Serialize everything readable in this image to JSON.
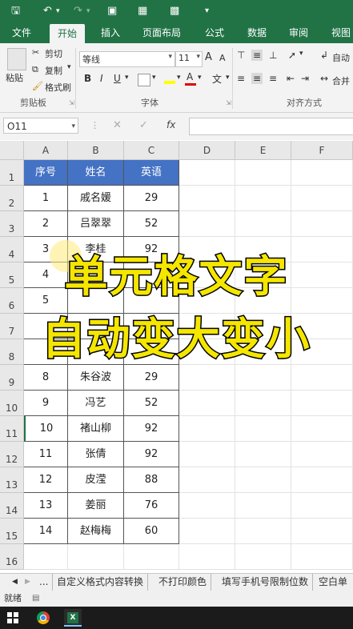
{
  "ribbon_tabs": [
    "文件",
    "开始",
    "插入",
    "页面布局",
    "公式",
    "数据",
    "审阅",
    "视图"
  ],
  "clipboard": {
    "paste": "粘贴",
    "cut": "剪切",
    "copy": "复制",
    "format_painter": "格式刷",
    "group": "剪贴板"
  },
  "font": {
    "name": "等线",
    "size": "11",
    "bold": "B",
    "italic": "I",
    "underline": "U",
    "group": "字体",
    "grow": "A",
    "shrink": "A",
    "color_a": "A",
    "wen": "文"
  },
  "alignment": {
    "wrap": "自动",
    "merge": "合并",
    "group": "对齐方式"
  },
  "name_box": "O11",
  "fx_label": "fx",
  "columns": [
    "A",
    "B",
    "C",
    "D",
    "E",
    "F"
  ],
  "rows": [
    "1",
    "2",
    "3",
    "4",
    "5",
    "6",
    "7",
    "8",
    "9",
    "10",
    "11",
    "12",
    "13",
    "14",
    "15",
    "16"
  ],
  "table": {
    "headers": [
      "序号",
      "姓名",
      "英语"
    ],
    "rows": [
      [
        "1",
        "戚名媛",
        "29"
      ],
      [
        "2",
        "吕翠翠",
        "52"
      ],
      [
        "3",
        "李桂",
        "92"
      ],
      [
        "4",
        "",
        "",
        ""
      ],
      [
        "5",
        "",
        "",
        ""
      ],
      [
        "",
        "",
        "",
        ""
      ],
      [
        "",
        "",
        "",
        ""
      ],
      [
        "8",
        "朱谷波",
        "29"
      ],
      [
        "9",
        "冯艺",
        "52"
      ],
      [
        "10",
        "褚山柳",
        "92"
      ],
      [
        "11",
        "张倩",
        "92"
      ],
      [
        "12",
        "皮滢",
        "88"
      ],
      [
        "13",
        "姜丽",
        "76"
      ],
      [
        "14",
        "赵梅梅",
        "60"
      ]
    ]
  },
  "overlay": {
    "line1": "单元格文字",
    "line2": "自动变大变小"
  },
  "sheet_tabs": [
    "...",
    "自定义格式内容转换",
    "不打印颜色",
    "填写手机号限制位数",
    "空白单"
  ],
  "status": "就绪",
  "colors": {
    "excel_green": "#217346",
    "header_blue": "#4472c4",
    "overlay_yellow": "#f5e600"
  }
}
